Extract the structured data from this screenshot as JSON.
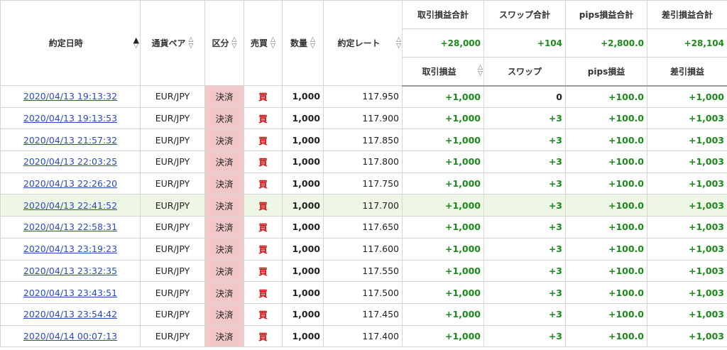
{
  "columns": {
    "datetime": "約定日時",
    "pair": "通貨ペア",
    "kubun": "区分",
    "side": "売買",
    "qty": "数量",
    "rate": "約定レート",
    "pl": "取引損益",
    "swap": "スワップ",
    "pips": "pips損益",
    "net": "差引損益"
  },
  "totals_labels": {
    "pl": "取引損益合計",
    "swap": "スワップ合計",
    "pips": "pips損益合計",
    "net": "差引損益合計"
  },
  "totals": {
    "pl": "+28,000",
    "swap": "+104",
    "pips": "+2,800.0",
    "net": "+28,104"
  },
  "sort_active_column": "datetime",
  "rows": [
    {
      "datetime": "2020/04/13 19:13:32",
      "pair": "EUR/JPY",
      "kubun": "決済",
      "side": "買",
      "qty": "1,000",
      "rate": "117.950",
      "pl": "+1,000",
      "swap": "0",
      "pips": "+100.0",
      "net": "+1,000"
    },
    {
      "datetime": "2020/04/13 19:13:53",
      "pair": "EUR/JPY",
      "kubun": "決済",
      "side": "買",
      "qty": "1,000",
      "rate": "117.900",
      "pl": "+1,000",
      "swap": "+3",
      "pips": "+100.0",
      "net": "+1,003"
    },
    {
      "datetime": "2020/04/13 21:57:32",
      "pair": "EUR/JPY",
      "kubun": "決済",
      "side": "買",
      "qty": "1,000",
      "rate": "117.850",
      "pl": "+1,000",
      "swap": "+3",
      "pips": "+100.0",
      "net": "+1,003"
    },
    {
      "datetime": "2020/04/13 22:03:25",
      "pair": "EUR/JPY",
      "kubun": "決済",
      "side": "買",
      "qty": "1,000",
      "rate": "117.800",
      "pl": "+1,000",
      "swap": "+3",
      "pips": "+100.0",
      "net": "+1,003"
    },
    {
      "datetime": "2020/04/13 22:26:20",
      "pair": "EUR/JPY",
      "kubun": "決済",
      "side": "買",
      "qty": "1,000",
      "rate": "117.750",
      "pl": "+1,000",
      "swap": "+3",
      "pips": "+100.0",
      "net": "+1,003"
    },
    {
      "datetime": "2020/04/13 22:41:52",
      "pair": "EUR/JPY",
      "kubun": "決済",
      "side": "買",
      "qty": "1,000",
      "rate": "117.700",
      "pl": "+1,000",
      "swap": "+3",
      "pips": "+100.0",
      "net": "+1,003"
    },
    {
      "datetime": "2020/04/13 22:58:31",
      "pair": "EUR/JPY",
      "kubun": "決済",
      "side": "買",
      "qty": "1,000",
      "rate": "117.650",
      "pl": "+1,000",
      "swap": "+3",
      "pips": "+100.0",
      "net": "+1,003"
    },
    {
      "datetime": "2020/04/13 23:19:23",
      "pair": "EUR/JPY",
      "kubun": "決済",
      "side": "買",
      "qty": "1,000",
      "rate": "117.600",
      "pl": "+1,000",
      "swap": "+3",
      "pips": "+100.0",
      "net": "+1,003"
    },
    {
      "datetime": "2020/04/13 23:32:35",
      "pair": "EUR/JPY",
      "kubun": "決済",
      "side": "買",
      "qty": "1,000",
      "rate": "117.550",
      "pl": "+1,000",
      "swap": "+3",
      "pips": "+100.0",
      "net": "+1,003"
    },
    {
      "datetime": "2020/04/13 23:43:51",
      "pair": "EUR/JPY",
      "kubun": "決済",
      "side": "買",
      "qty": "1,000",
      "rate": "117.500",
      "pl": "+1,000",
      "swap": "+3",
      "pips": "+100.0",
      "net": "+1,003"
    },
    {
      "datetime": "2020/04/13 23:54:42",
      "pair": "EUR/JPY",
      "kubun": "決済",
      "side": "買",
      "qty": "1,000",
      "rate": "117.450",
      "pl": "+1,000",
      "swap": "+3",
      "pips": "+100.0",
      "net": "+1,003"
    },
    {
      "datetime": "2020/04/14 00:07:13",
      "pair": "EUR/JPY",
      "kubun": "決済",
      "side": "買",
      "qty": "1,000",
      "rate": "117.400",
      "pl": "+1,000",
      "swap": "+3",
      "pips": "+100.0",
      "net": "+1,003"
    }
  ],
  "highlighted_row": 5,
  "colors": {
    "positive": "#1a8a1a",
    "buy": "#cc1111",
    "link": "#2a4bbf",
    "kubun_bg": "#f2c7c7",
    "highlight_bg": "#eef7e6"
  }
}
